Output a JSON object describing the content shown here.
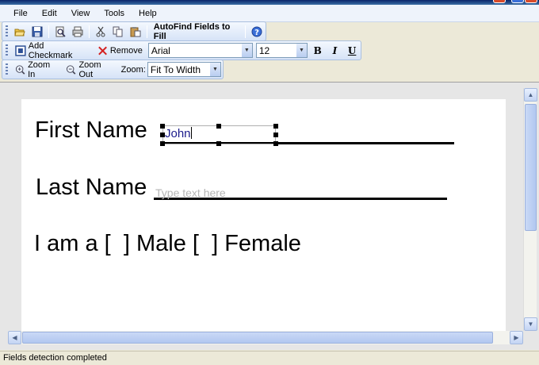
{
  "menu": [
    "File",
    "Edit",
    "View",
    "Tools",
    "Help"
  ],
  "toolbar1": {
    "icons": [
      "open-icon",
      "save-icon",
      "print-preview-icon",
      "print-icon",
      "cut-icon",
      "copy-icon",
      "paste-icon",
      "help-icon"
    ],
    "autofind_label": "AutoFind Fields to Fill"
  },
  "toolbar2": {
    "add_checkmark_label": "Add Checkmark",
    "remove_label": "Remove",
    "font_value": "Arial",
    "size_value": "12",
    "bold_label": "B",
    "italic_label": "I",
    "underline_label": "U"
  },
  "toolbar3": {
    "zoom_in_label": "Zoom In",
    "zoom_out_label": "Zoom Out",
    "zoom_caption": "Zoom:",
    "zoom_value": "Fit To Width"
  },
  "document": {
    "first_name_label": "First Name",
    "first_name_value": "John",
    "last_name_label": "Last Name",
    "last_name_placeholder": "Type text here",
    "gender_prefix": "I am a",
    "bracket_open": "[",
    "bracket_close": "]",
    "male_label": "Male",
    "female_label": "Female"
  },
  "status": "Fields detection completed",
  "colors": {
    "toolbar_top": "#f4f8fe",
    "toolbar_bottom": "#d6e3f7",
    "field_text": "#1a1a8a",
    "placeholder": "#b5b5b5",
    "remove_x": "#d42020"
  }
}
